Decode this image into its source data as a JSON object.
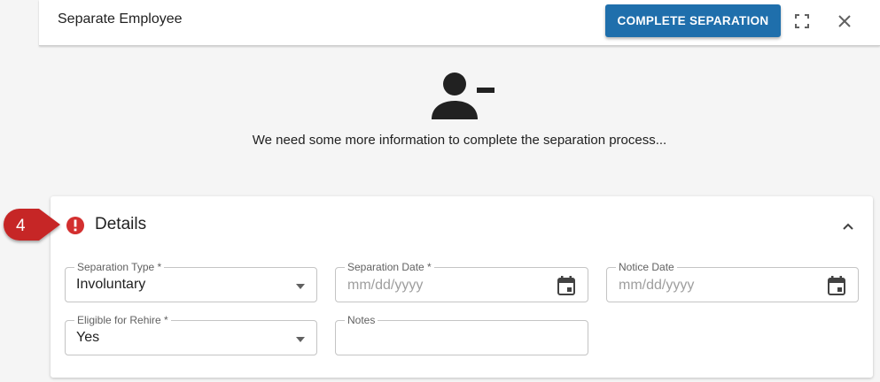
{
  "dialog": {
    "title": "Separate Employee",
    "complete_button_label": "COMPLETE SEPARATION",
    "fullscreen_icon": "fullscreen-icon",
    "close_icon": "close-icon"
  },
  "hero": {
    "icon": "person-remove-icon",
    "message": "We need some more information to complete the separation process..."
  },
  "callout": {
    "number": "4",
    "color": "#c62828"
  },
  "details": {
    "title": "Details",
    "status_icon": "error-icon",
    "collapse_icon": "chevron-up-icon",
    "fields": {
      "separation_type": {
        "label": "Separation Type *",
        "value": "Involuntary"
      },
      "separation_date": {
        "label": "Separation Date *",
        "placeholder": "mm/dd/yyyy"
      },
      "notice_date": {
        "label": "Notice Date",
        "placeholder": "mm/dd/yyyy"
      },
      "eligible_for_rehire": {
        "label": "Eligible for Rehire *",
        "value": "Yes"
      },
      "notes": {
        "label": "Notes",
        "value": ""
      }
    }
  },
  "colors": {
    "primary": "#1f6fac",
    "error": "#d32f2f",
    "background": "#f5f5f5"
  }
}
